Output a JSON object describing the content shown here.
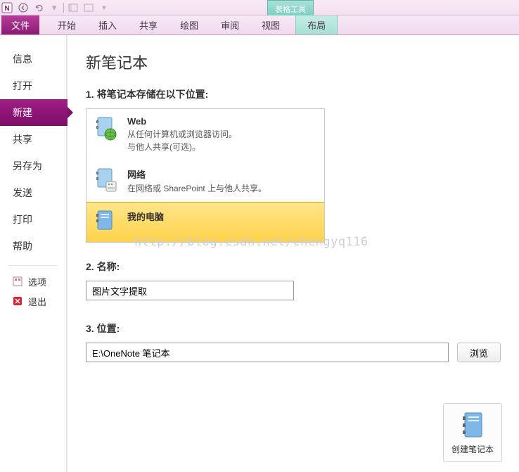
{
  "titlebar": {
    "contextual_label": "表格工具"
  },
  "ribbon": {
    "file": "文件",
    "tabs": [
      "开始",
      "插入",
      "共享",
      "绘图",
      "审阅",
      "视图"
    ],
    "layout": "布局"
  },
  "sidebar": {
    "items": [
      "信息",
      "打开",
      "新建",
      "共享",
      "另存为",
      "发送",
      "打印",
      "帮助"
    ],
    "active_index": 2,
    "options": "选项",
    "exit": "退出"
  },
  "main": {
    "heading": "新笔记本",
    "step1": "1. 将笔记本存储在以下位置:",
    "storage": [
      {
        "title": "Web",
        "lines": [
          "从任何计算机或浏览器访问。",
          "与他人共享(可选)。"
        ]
      },
      {
        "title": "网络",
        "lines": [
          "在网络或 SharePoint 上与他人共享。"
        ]
      },
      {
        "title": "我的电脑",
        "lines": []
      }
    ],
    "selected_storage_index": 2,
    "step2": "2. 名称:",
    "name_value": "图片文字提取",
    "step3": "3. 位置:",
    "location_value": "E:\\OneNote 笔记本",
    "browse": "浏览",
    "create": "创建笔记本",
    "watermark": "http://blog.csdn.net/chengyq116"
  },
  "colors": {
    "accent": "#8a1a74",
    "contextual": "#7dcfc3",
    "selected": "#ffd24a"
  }
}
